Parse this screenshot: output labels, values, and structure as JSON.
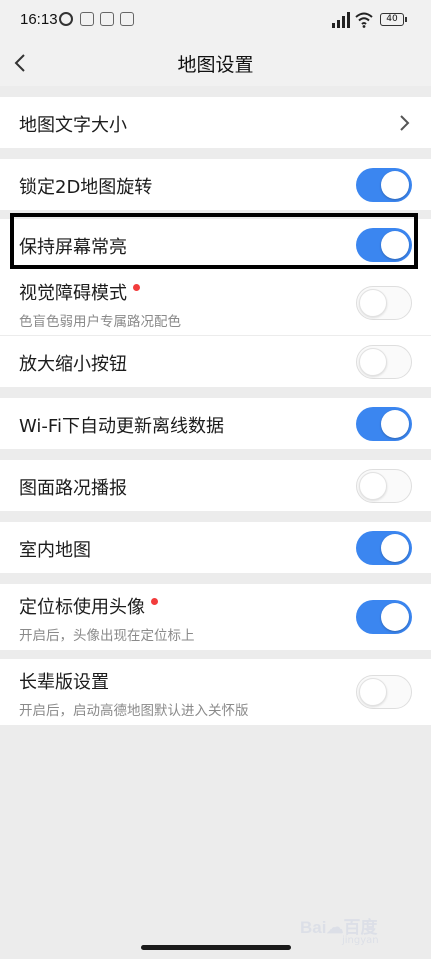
{
  "status_bar": {
    "time": "16:13",
    "battery": "40"
  },
  "header": {
    "title": "地图设置"
  },
  "settings": [
    {
      "label": "地图文字大小",
      "control": "chevron"
    },
    {
      "label": "锁定2D地图旋转",
      "control": "toggle",
      "on": true
    },
    {
      "label": "保持屏幕常亮",
      "control": "toggle",
      "on": true,
      "highlighted": true
    },
    {
      "label": "视觉障碍模式",
      "sub": "色盲色弱用户专属路况配色",
      "control": "toggle",
      "on": false,
      "badge": "red-dot"
    },
    {
      "label": "放大缩小按钮",
      "control": "toggle",
      "on": false
    },
    {
      "label": "Wi-Fi下自动更新离线数据",
      "control": "toggle",
      "on": true
    },
    {
      "label": "图面路况播报",
      "control": "toggle",
      "on": false
    },
    {
      "label": "室内地图",
      "control": "toggle",
      "on": true
    },
    {
      "label": "定位标使用头像",
      "sub": "开启后，头像出现在定位标上",
      "control": "toggle",
      "on": true,
      "badge": "red-dot"
    },
    {
      "label": "长辈版设置",
      "sub": "开启后，启动高德地图默认进入关怀版",
      "control": "toggle",
      "on": false
    }
  ],
  "colors": {
    "toggle_on": "#3b86f0",
    "badge": "#f23c3c",
    "background": "#ececec"
  }
}
